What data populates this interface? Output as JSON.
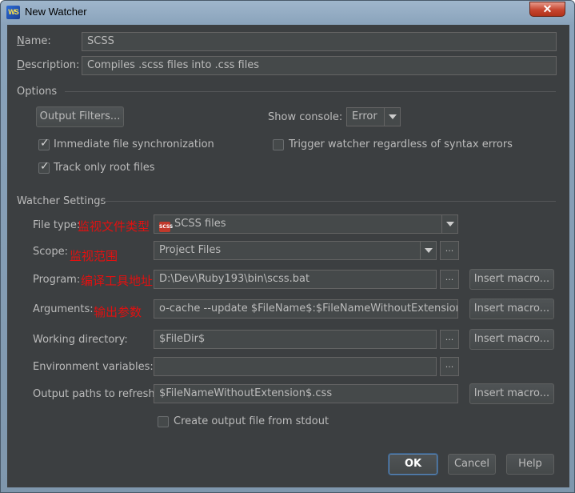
{
  "window": {
    "title": "New Watcher",
    "close_symbol": "✕",
    "app_icon_text": "WS"
  },
  "name": {
    "label": "Name:",
    "value": "SCSS"
  },
  "description": {
    "label": "Description:",
    "value": "Compiles .scss files into .css files"
  },
  "options": {
    "section_title": "Options",
    "output_filters_button": "Output Filters...",
    "show_console_label": "Show console:",
    "show_console_value": "Error",
    "immediate_sync": {
      "label": "Immediate file synchronization",
      "checked": true
    },
    "track_root": {
      "label": "Track only root files",
      "checked": true
    },
    "trigger_watcher": {
      "label": "Trigger watcher regardless of syntax errors",
      "checked": false
    }
  },
  "watcher_settings": {
    "section_title": "Watcher Settings",
    "file_type": {
      "label": "File type:",
      "value": "SCSS files",
      "icon_text": "SCSS",
      "annotation": "监视文件类型"
    },
    "scope": {
      "label": "Scope:",
      "value": "Project Files",
      "annotation": "监视范围"
    },
    "program": {
      "label": "Program:",
      "value": "D:\\Dev\\Ruby193\\bin\\scss.bat",
      "annotation": "编译工具地址"
    },
    "arguments": {
      "label": "Arguments:",
      "value": "o-cache --update $FileName$:$FileNameWithoutExtension$.css",
      "annotation": "输出参数"
    },
    "working_directory": {
      "label": "Working directory:",
      "value": "$FileDir$"
    },
    "environment_variables": {
      "label": "Environment variables:",
      "value": ""
    },
    "output_paths": {
      "label": "Output paths to refresh:",
      "value": "$FileNameWithoutExtension$.css"
    },
    "create_output": {
      "label": "Create output file from stdout",
      "checked": false
    },
    "browse_label": "...",
    "insert_macro_label": "Insert macro..."
  },
  "footer": {
    "ok": "OK",
    "cancel": "Cancel",
    "help": "Help"
  },
  "colors": {
    "background": "#3c3f41",
    "field": "#45494a",
    "text": "#bbbbbb",
    "annotation": "#e21010"
  }
}
